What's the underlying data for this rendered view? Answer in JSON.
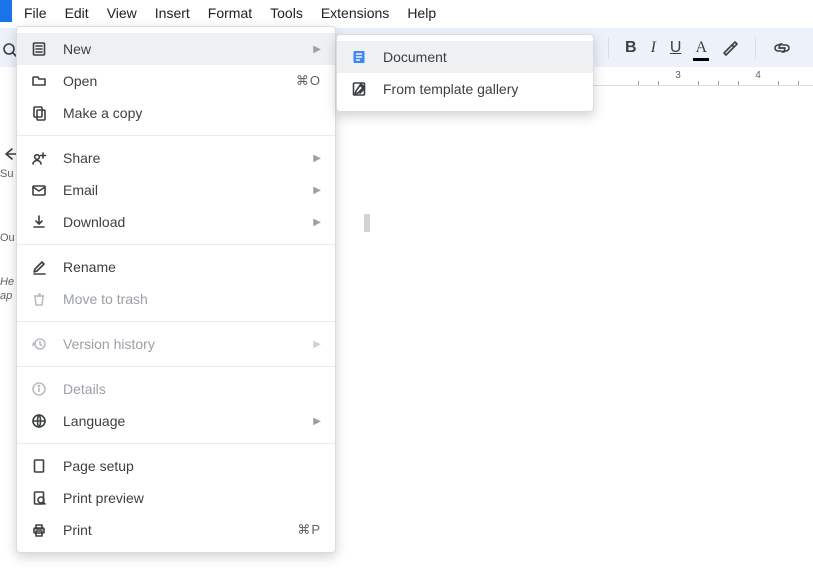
{
  "menubar": {
    "items": [
      "File",
      "Edit",
      "View",
      "Insert",
      "Format",
      "Tools",
      "Extensions",
      "Help"
    ]
  },
  "toolbar": {
    "bold": "B",
    "italic": "I",
    "underline": "U",
    "text_color": "A"
  },
  "ruler": {
    "marks": [
      "3",
      "4"
    ]
  },
  "left_sidebar": {
    "summary_label_partial": "Su",
    "outline_label_partial": "Ou",
    "hint_line1_partial": "He",
    "hint_line2_partial": "ap"
  },
  "file_menu": {
    "new": "New",
    "open": "Open",
    "open_shortcut": "⌘O",
    "make_a_copy": "Make a copy",
    "share": "Share",
    "email": "Email",
    "download": "Download",
    "rename": "Rename",
    "move_to_trash": "Move to trash",
    "version_history": "Version history",
    "details": "Details",
    "language": "Language",
    "page_setup": "Page setup",
    "print_preview": "Print preview",
    "print": "Print",
    "print_shortcut": "⌘P"
  },
  "new_submenu": {
    "document": "Document",
    "from_template": "From template gallery"
  }
}
